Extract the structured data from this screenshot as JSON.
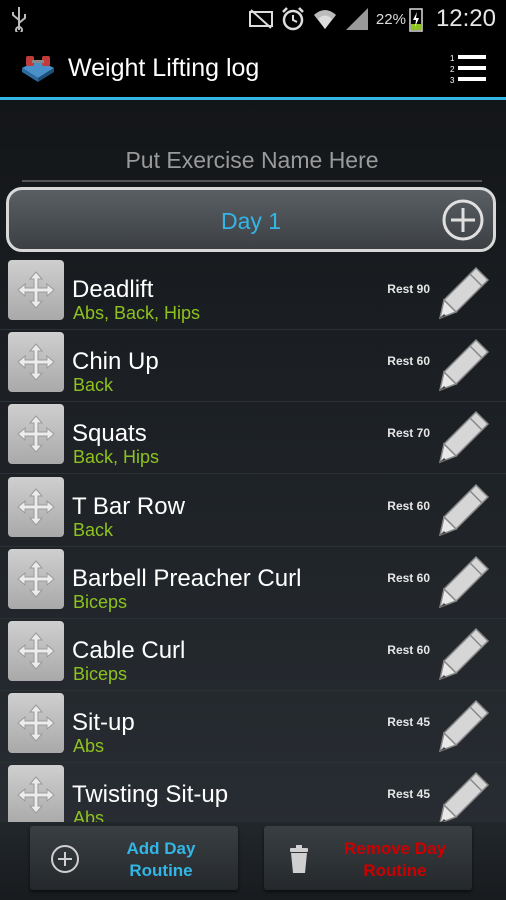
{
  "status_bar": {
    "battery_percent": "22%",
    "time": "12:20",
    "icons": [
      "usb-icon",
      "mute-icon",
      "alarm-icon",
      "wifi-icon",
      "signal-icon",
      "battery-charging-icon"
    ]
  },
  "action_bar": {
    "title": "Weight Lifting log",
    "app_icon": "dumbbell-app-icon",
    "menu_icon": "numbered-list-icon"
  },
  "exercise_input": {
    "placeholder": "Put Exercise Name Here",
    "value": ""
  },
  "day": {
    "title": "Day 1",
    "add_icon": "plus-circle-icon"
  },
  "exercises": [
    {
      "name": "Deadlift",
      "muscles": "Abs, Back, Hips",
      "rest": "Rest 90"
    },
    {
      "name": "Chin Up",
      "muscles": "Back",
      "rest": "Rest 60"
    },
    {
      "name": "Squats",
      "muscles": "Back, Hips",
      "rest": "Rest 70"
    },
    {
      "name": "T Bar Row",
      "muscles": "Back",
      "rest": "Rest 60"
    },
    {
      "name": "Barbell Preacher Curl",
      "muscles": "Biceps",
      "rest": "Rest 60"
    },
    {
      "name": "Cable Curl",
      "muscles": "Biceps",
      "rest": "Rest 60"
    },
    {
      "name": "Sit-up",
      "muscles": "Abs",
      "rest": "Rest 45"
    },
    {
      "name": "Twisting Sit-up",
      "muscles": "Abs",
      "rest": "Rest 45"
    }
  ],
  "bottom_bar": {
    "add_label_line1": "Add Day",
    "add_label_line2": "Routine",
    "remove_label_line1": "Remove Day",
    "remove_label_line2": "Routine"
  },
  "colors": {
    "accent": "#33b5e5",
    "muscle_text": "#8dc21f",
    "remove_text": "#cc0000"
  }
}
